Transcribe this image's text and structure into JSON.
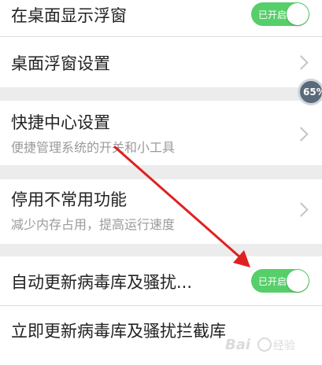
{
  "settings": {
    "float_window_toggle": {
      "title": "在桌面显示浮窗",
      "state_label": "已开启"
    },
    "float_window_settings": {
      "title": "桌面浮窗设置"
    },
    "shortcut_center": {
      "title": "快捷中心设置",
      "subtitle": "便捷管理系统的开关和小工具"
    },
    "disable_unused": {
      "title": "停用不常用功能",
      "subtitle": "减少内存占用，提高运行速度"
    },
    "auto_update_virus_db": {
      "title": "自动更新病毒库及骚扰...",
      "state_label": "已开启"
    },
    "update_now": {
      "title": "立即更新病毒库及骚扰拦截库"
    }
  },
  "floating_ball": {
    "percent": "65%"
  },
  "colors": {
    "toggle_on": "#56cf6a",
    "annotation_arrow": "#e02020"
  },
  "watermark": {
    "logo": "Baidu 经验"
  }
}
